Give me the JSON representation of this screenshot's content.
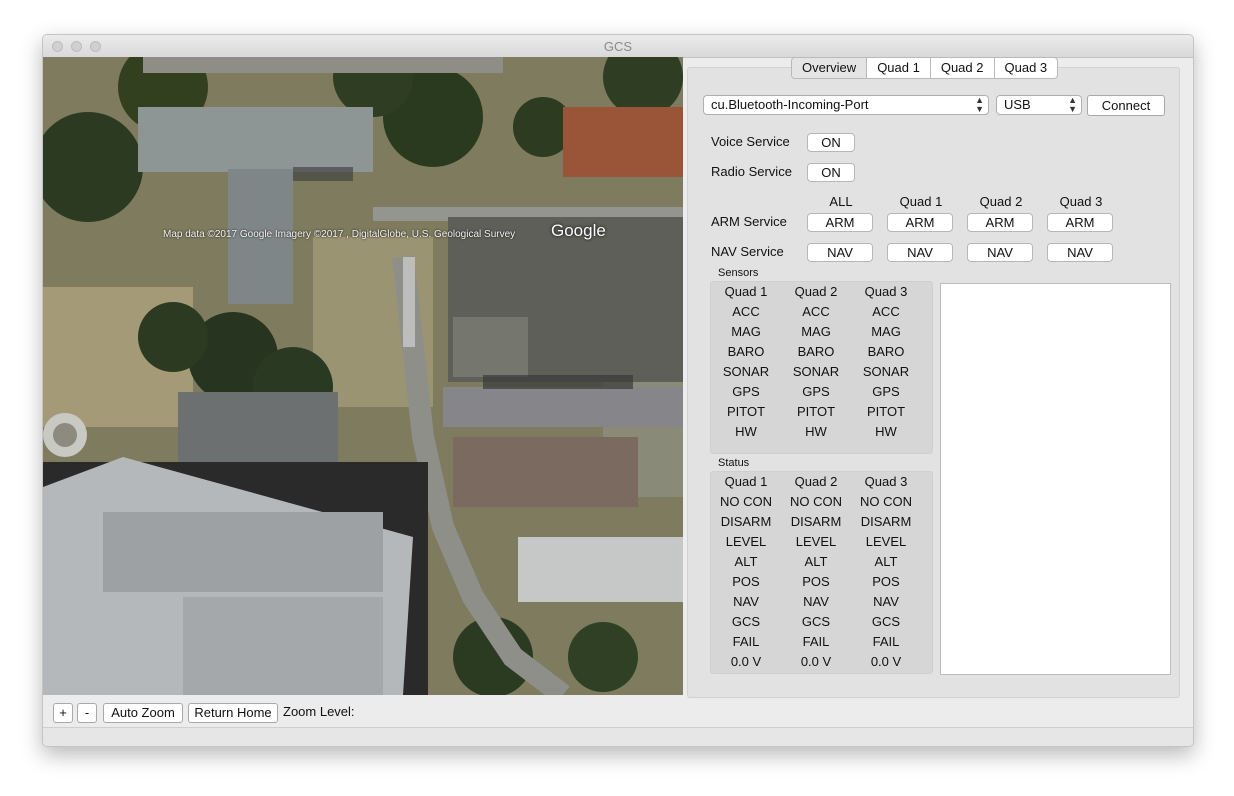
{
  "window": {
    "title": "GCS"
  },
  "map": {
    "attribution": "Map data ©2017 Google  Imagery ©2017 , DigitalGlobe, U.S. Geological Survey",
    "logo": "Google"
  },
  "bottom_bar": {
    "zoom_in": "+",
    "zoom_out": "-",
    "auto_zoom": "Auto Zoom",
    "return_home": "Return Home",
    "zoom_level_label": "Zoom Level:"
  },
  "tabs": [
    "Overview",
    "Quad 1",
    "Quad 2",
    "Quad 3"
  ],
  "connection": {
    "port": "cu.Bluetooth-Incoming-Port",
    "type": "USB",
    "connect": "Connect"
  },
  "services": {
    "voice_label": "Voice Service",
    "voice_state": "ON",
    "radio_label": "Radio Service",
    "radio_state": "ON",
    "column_headers": [
      "ALL",
      "Quad 1",
      "Quad 2",
      "Quad 3"
    ],
    "arm_label": "ARM Service",
    "arm_buttons": [
      "ARM",
      "ARM",
      "ARM",
      "ARM"
    ],
    "nav_label": "NAV Service",
    "nav_buttons": [
      "NAV",
      "NAV",
      "NAV",
      "NAV"
    ]
  },
  "sensors": {
    "title": "Sensors",
    "headers": [
      "Quad 1",
      "Quad 2",
      "Quad 3"
    ],
    "rows": [
      "ACC",
      "MAG",
      "BARO",
      "SONAR",
      "GPS",
      "PITOT",
      "HW"
    ]
  },
  "status": {
    "title": "Status",
    "headers": [
      "Quad 1",
      "Quad 2",
      "Quad 3"
    ],
    "rows": [
      "NO CON",
      "DISARM",
      "LEVEL",
      "ALT",
      "POS",
      "NAV",
      "GCS",
      "FAIL",
      "0.0 V"
    ]
  },
  "colors": {
    "panel_bg": "#e2e2e2",
    "group_bg": "#d6d6d6",
    "window_bg": "#ececec"
  }
}
